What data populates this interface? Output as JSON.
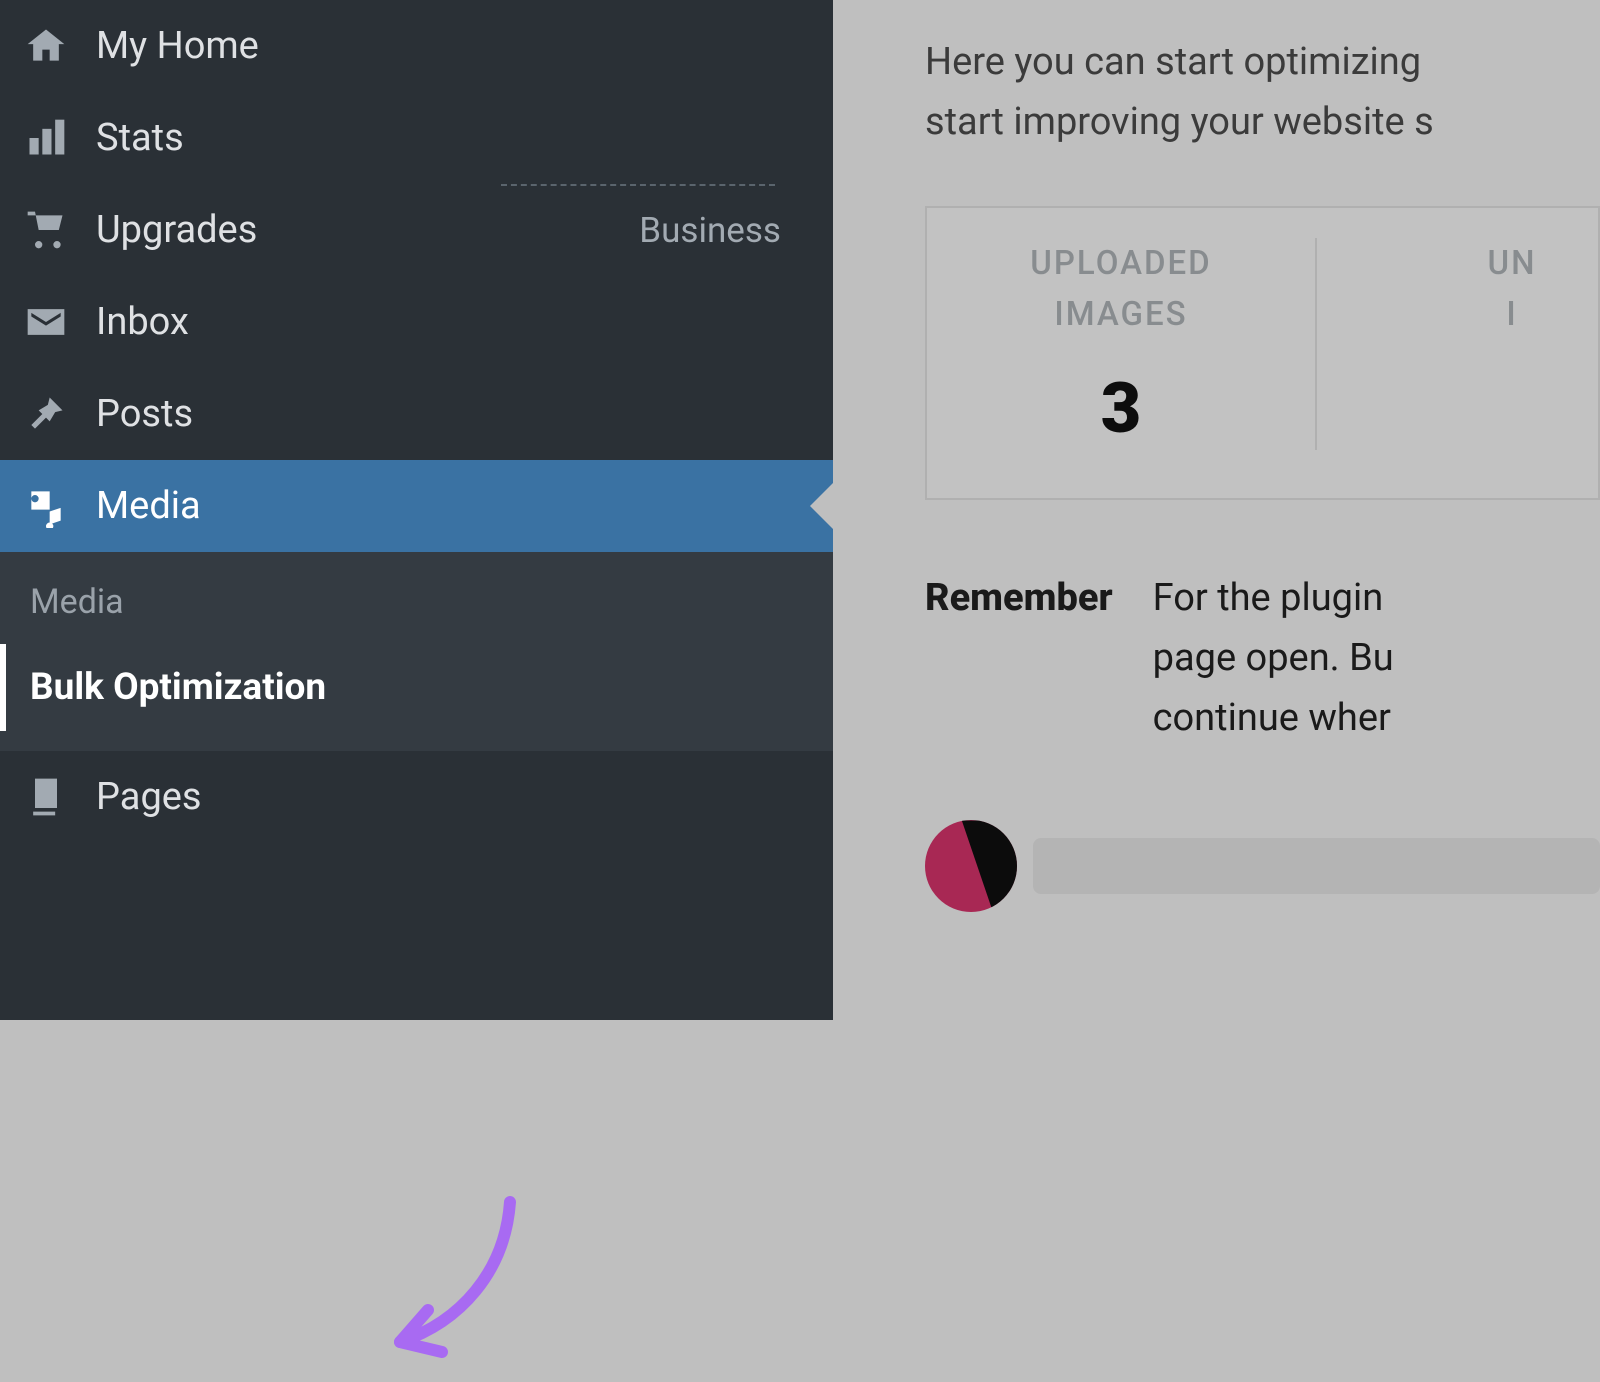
{
  "sidebar": {
    "items": [
      {
        "label": "My Home",
        "icon": "home"
      },
      {
        "label": "Stats",
        "icon": "stats"
      },
      {
        "label": "Upgrades",
        "icon": "upgrades",
        "meta": "Business"
      },
      {
        "label": "Inbox",
        "icon": "inbox"
      },
      {
        "label": "Posts",
        "icon": "posts"
      },
      {
        "label": "Media",
        "icon": "media"
      },
      {
        "label": "Pages",
        "icon": "pages"
      }
    ],
    "active_index": 5,
    "submenu": {
      "title": "Media",
      "items": [
        {
          "label": "Bulk Optimization"
        }
      ],
      "current_index": 0
    }
  },
  "main": {
    "intro_line1": "Here you can start optimizing",
    "intro_line2": "start improving your website s",
    "stats": [
      {
        "label_line1": "UPLOADED",
        "label_line2": "IMAGES",
        "value": "3"
      },
      {
        "label_line1": "UN",
        "label_line2": "I"
      }
    ],
    "remember_label": "Remember",
    "remember_line1": "For the plugin",
    "remember_line2": "page open. Bu",
    "remember_line3": "continue wher"
  },
  "colors": {
    "sidebar_bg": "#2a3036",
    "sidebar_active": "#3a72a3",
    "submenu_bg": "#343b42",
    "content_bg": "#bfbfbf",
    "arrow": "#a86af2",
    "progress_dot_a": "#a82854",
    "progress_dot_b": "#0c0c0c"
  }
}
